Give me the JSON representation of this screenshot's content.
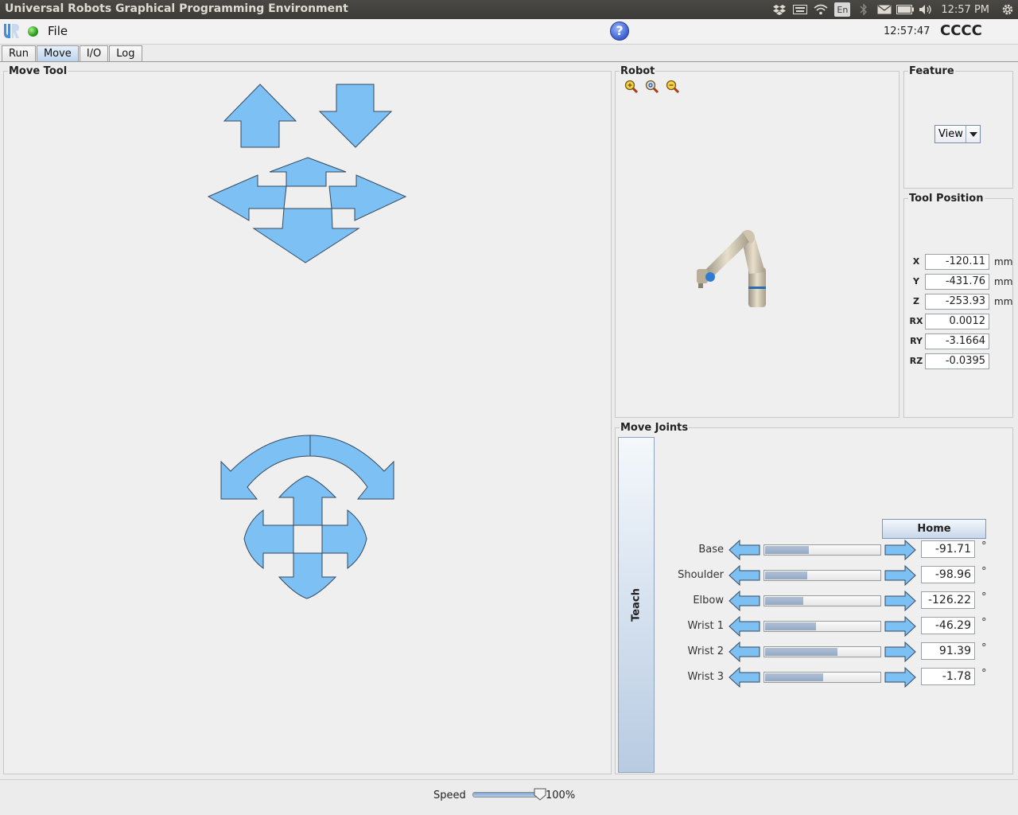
{
  "window": {
    "title": "Universal Robots Graphical Programming Environment"
  },
  "system_tray": {
    "language": "En",
    "clock": "12:57 PM"
  },
  "header": {
    "menu_file": "File",
    "help_label": "?",
    "time": "12:57:47",
    "robot_name": "CCCC"
  },
  "tabs": [
    {
      "label": "Run",
      "active": false
    },
    {
      "label": "Move",
      "active": true
    },
    {
      "label": "I/O",
      "active": false
    },
    {
      "label": "Log",
      "active": false
    }
  ],
  "move_tool": {
    "title": "Move Tool"
  },
  "robot": {
    "title": "Robot"
  },
  "feature": {
    "title": "Feature",
    "selected": "View"
  },
  "tool_position": {
    "title": "Tool Position",
    "rows": [
      {
        "label": "X",
        "value": "-120.11",
        "unit": "mm"
      },
      {
        "label": "Y",
        "value": "-431.76",
        "unit": "mm"
      },
      {
        "label": "Z",
        "value": "-253.93",
        "unit": "mm"
      },
      {
        "label": "RX",
        "value": "0.0012",
        "unit": ""
      },
      {
        "label": "RY",
        "value": "-3.1664",
        "unit": ""
      },
      {
        "label": "RZ",
        "value": "-0.0395",
        "unit": ""
      }
    ]
  },
  "move_joints": {
    "title": "Move Joints",
    "teach_label": "Teach",
    "home_label": "Home",
    "joints": [
      {
        "label": "Base",
        "value": "-91.71",
        "unit": "°",
        "position_fraction": 0.38
      },
      {
        "label": "Shoulder",
        "value": "-98.96",
        "unit": "°",
        "position_fraction": 0.36
      },
      {
        "label": "Elbow",
        "value": "-126.22",
        "unit": "°",
        "position_fraction": 0.33
      },
      {
        "label": "Wrist 1",
        "value": "-46.29",
        "unit": "°",
        "position_fraction": 0.44
      },
      {
        "label": "Wrist 2",
        "value": "91.39",
        "unit": "°",
        "position_fraction": 0.62
      },
      {
        "label": "Wrist 3",
        "value": "-1.78",
        "unit": "°",
        "position_fraction": 0.5
      }
    ]
  },
  "speed": {
    "label": "Speed",
    "value": "100%",
    "fraction": 1.0
  },
  "colors": {
    "arrow_fill": "#7cc0f4",
    "arrow_stroke": "#34495e",
    "accent": "#b9d2ee"
  }
}
